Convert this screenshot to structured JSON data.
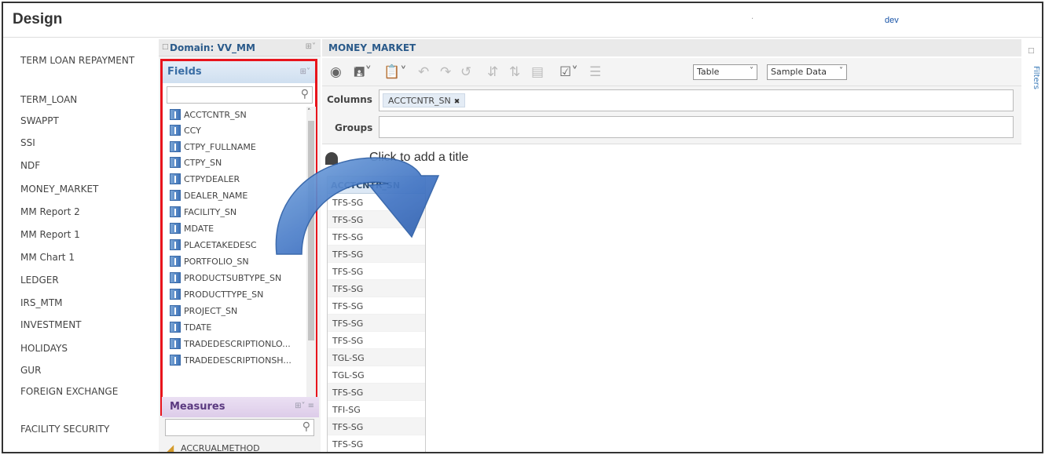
{
  "header": {
    "title": "Design",
    "dot": ".",
    "user": "dev"
  },
  "sidebar": {
    "items": [
      {
        "label": "TERM LOAN REPAYMENT"
      },
      {
        "label": "TERM_LOAN"
      },
      {
        "label": "SWAPPT"
      },
      {
        "label": "SSI"
      },
      {
        "label": "NDF"
      },
      {
        "label": "MONEY_MARKET"
      },
      {
        "label": "MM Report 2"
      },
      {
        "label": "MM Report 1"
      },
      {
        "label": "MM Chart 1"
      },
      {
        "label": "LEDGER"
      },
      {
        "label": "IRS_MTM"
      },
      {
        "label": "INVESTMENT"
      },
      {
        "label": "HOLIDAYS"
      },
      {
        "label": "GUR"
      },
      {
        "label": "FOREIGN EXCHANGE"
      },
      {
        "label": "FACILITY SECURITY"
      }
    ]
  },
  "domain": {
    "label": "Domain: VV_MM"
  },
  "fields": {
    "label": "Fields",
    "search_placeholder": "",
    "items": [
      "ACCTCNTR_SN",
      "CCY",
      "CTPY_FULLNAME",
      "CTPY_SN",
      "CTPYDEALER",
      "DEALER_NAME",
      "FACILITY_SN",
      "MDATE",
      "PLACETAKEDESC",
      "PORTFOLIO_SN",
      "PRODUCTSUBTYPE_SN",
      "PRODUCTTYPE_SN",
      "PROJECT_SN",
      "TDATE",
      "TRADEDESCRIPTIONLO...",
      "TRADEDESCRIPTIONSH..."
    ]
  },
  "measures": {
    "label": "Measures",
    "items": [
      "ACCRUALMETHOD"
    ]
  },
  "report": {
    "name": "MONEY_MARKET",
    "view_select": "Table",
    "data_select": "Sample Data",
    "columns_label": "Columns",
    "groups_label": "Groups",
    "column_chip": "ACCTCNTR_SN",
    "title_placeholder": "Click to add a title",
    "table_header": "ACCTCNTR_SN",
    "rows": [
      "TFS-SG",
      "TFS-SG",
      "TFS-SG",
      "TFS-SG",
      "TFS-SG",
      "TFS-SG",
      "TFS-SG",
      "TFS-SG",
      "TFS-SG",
      "TGL-SG",
      "TGL-SG",
      "TFS-SG",
      "TFI-SG",
      "TFS-SG",
      "TFS-SG"
    ]
  },
  "right_panel": {
    "label": "Filters"
  },
  "colors": {
    "highlight": "#e8141c",
    "arrow": "#4a7fc8",
    "accent": "#2a5a8a"
  }
}
